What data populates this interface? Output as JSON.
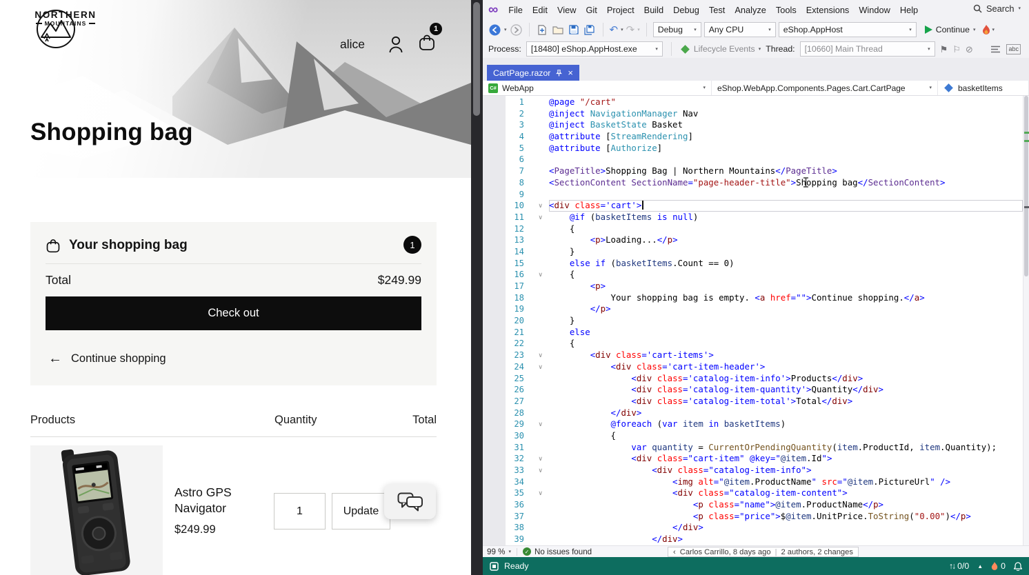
{
  "colors": {
    "status_bar": "#0D6D5F",
    "active_tab": "#4663D2",
    "checkout_button": "#0D0D0D",
    "badge": "#0B0B0B",
    "line_number": "#2B91AF"
  },
  "icons": {
    "logo_infinity": "∞",
    "back_arrow": "←",
    "forward_arrow": "→",
    "undo": "↶",
    "redo": "↷",
    "caret_down": "▾",
    "caret_up": "▲",
    "close": "×",
    "check": "✓",
    "flag": "⚑",
    "flag_outline": "⚐",
    "slash_circle": "⊘",
    "continue_left_arrow": "←",
    "fold_chevron": "∨",
    "sync_arrows": "↑↓",
    "blame_chevron": "‹",
    "pipe": "|"
  },
  "browser": {
    "logo": {
      "name_top": "NORTHERN",
      "name_bottom": "MOUNTAINS"
    },
    "nav": {
      "username": "alice",
      "cart_count": "1"
    },
    "hero": {
      "title": "Shopping bag"
    },
    "summary": {
      "title": "Your shopping bag",
      "badge": "1",
      "total_label": "Total",
      "total_value": "$249.99",
      "checkout": "Check out",
      "continue_shopping": "Continue shopping"
    },
    "cart": {
      "columns": [
        "Products",
        "Quantity",
        "Total"
      ],
      "item": {
        "name": "Astro GPS Navigator",
        "price": "$249.99",
        "quantity": "1",
        "update": "Update"
      }
    }
  },
  "ide": {
    "menus": [
      "File",
      "Edit",
      "View",
      "Git",
      "Project",
      "Build",
      "Debug",
      "Test",
      "Analyze",
      "Tools",
      "Extensions",
      "Window",
      "Help"
    ],
    "search": "Search",
    "toolbar": {
      "configuration": "Debug",
      "platform": "Any CPU",
      "startup_project": "eShop.AppHost",
      "continue_label": "Continue"
    },
    "debug_toolbar": {
      "process_label": "Process:",
      "process": "[18480] eShop.AppHost.exe",
      "lifecycle_events": "Lifecycle Events",
      "thread_label": "Thread:",
      "thread": "[10660] Main Thread"
    },
    "tabs": [
      {
        "title": "CartPage.razor",
        "active": true
      }
    ],
    "navigation_bar": {
      "project": "WebApp",
      "type": "eShop.WebApp.Components.Pages.Cart.CartPage",
      "member": "basketItems"
    },
    "editor": {
      "current_line": 10,
      "folds": [
        10,
        11,
        16,
        23,
        24,
        29,
        32,
        33,
        35
      ],
      "lines": [
        [
          [
            "@page",
            "k"
          ],
          [
            " "
          ],
          [
            "\"/cart\"",
            "s"
          ]
        ],
        [
          [
            "@inject",
            "k"
          ],
          [
            " "
          ],
          [
            "NavigationManager",
            "t"
          ],
          [
            " Nav"
          ]
        ],
        [
          [
            "@inject",
            "k"
          ],
          [
            " "
          ],
          [
            "BasketState",
            "t"
          ],
          [
            " Basket"
          ]
        ],
        [
          [
            "@attribute",
            "k"
          ],
          [
            " ["
          ],
          [
            "StreamRendering",
            "t"
          ],
          [
            "]"
          ]
        ],
        [
          [
            "@attribute",
            "k"
          ],
          [
            " ["
          ],
          [
            "Authorize",
            "t"
          ],
          [
            "]"
          ]
        ],
        [],
        [
          [
            "<",
            "p"
          ],
          [
            "PageTitle",
            "cmp"
          ],
          [
            ">",
            "p"
          ],
          [
            "Shopping Bag | Northern Mountains"
          ],
          [
            "</",
            "p"
          ],
          [
            "PageTitle",
            "cmp"
          ],
          [
            ">",
            "p"
          ]
        ],
        [
          [
            "<",
            "p"
          ],
          [
            "SectionContent",
            "cmp"
          ],
          [
            " "
          ],
          [
            "SectionName",
            "cmp"
          ],
          [
            "=",
            "p"
          ],
          [
            "\"page-header-title\"",
            "s"
          ],
          [
            ">",
            "p"
          ],
          [
            "Shopping bag"
          ],
          [
            "</",
            "p"
          ],
          [
            "SectionContent",
            "cmp"
          ],
          [
            ">",
            "p"
          ]
        ],
        [],
        [
          [
            "<",
            "p"
          ],
          [
            "div",
            "h"
          ],
          [
            " "
          ],
          [
            "class",
            "a"
          ],
          [
            "=",
            "p"
          ],
          [
            "'cart'",
            "v"
          ],
          [
            ">",
            "p"
          ]
        ],
        [
          [
            "    "
          ],
          [
            "@if",
            "k"
          ],
          [
            " ("
          ],
          [
            "basketItems",
            "loc"
          ],
          [
            " "
          ],
          [
            "is",
            "k"
          ],
          [
            " "
          ],
          [
            "null",
            "k"
          ],
          [
            ")"
          ]
        ],
        [
          [
            "    {"
          ]
        ],
        [
          [
            "        "
          ],
          [
            "<",
            "p"
          ],
          [
            "p",
            "h"
          ],
          [
            ">",
            "p"
          ],
          [
            "Loading..."
          ],
          [
            "</",
            "p"
          ],
          [
            "p",
            "h"
          ],
          [
            ">",
            "p"
          ]
        ],
        [
          [
            "    }"
          ]
        ],
        [
          [
            "    "
          ],
          [
            "else",
            "k"
          ],
          [
            " "
          ],
          [
            "if",
            "k"
          ],
          [
            " ("
          ],
          [
            "basketItems",
            "loc"
          ],
          [
            ".Count == 0)"
          ]
        ],
        [
          [
            "    {"
          ]
        ],
        [
          [
            "        "
          ],
          [
            "<",
            "p"
          ],
          [
            "p",
            "h"
          ],
          [
            ">",
            "p"
          ]
        ],
        [
          [
            "            Your shopping bag is empty. "
          ],
          [
            "<",
            "p"
          ],
          [
            "a",
            "h"
          ],
          [
            " "
          ],
          [
            "href",
            "a"
          ],
          [
            "=",
            "p"
          ],
          [
            "\"\"",
            "v"
          ],
          [
            ">",
            "p"
          ],
          [
            "Continue shopping."
          ],
          [
            "</",
            "p"
          ],
          [
            "a",
            "h"
          ],
          [
            ">",
            "p"
          ]
        ],
        [
          [
            "        "
          ],
          [
            "</",
            "p"
          ],
          [
            "p",
            "h"
          ],
          [
            ">",
            "p"
          ]
        ],
        [
          [
            "    }"
          ]
        ],
        [
          [
            "    "
          ],
          [
            "else",
            "k"
          ]
        ],
        [
          [
            "    {"
          ]
        ],
        [
          [
            "        "
          ],
          [
            "<",
            "p"
          ],
          [
            "div",
            "h"
          ],
          [
            " "
          ],
          [
            "class",
            "a"
          ],
          [
            "=",
            "p"
          ],
          [
            "'cart-items'",
            "v"
          ],
          [
            ">",
            "p"
          ]
        ],
        [
          [
            "            "
          ],
          [
            "<",
            "p"
          ],
          [
            "div",
            "h"
          ],
          [
            " "
          ],
          [
            "class",
            "a"
          ],
          [
            "=",
            "p"
          ],
          [
            "'cart-item-header'",
            "v"
          ],
          [
            ">",
            "p"
          ]
        ],
        [
          [
            "                "
          ],
          [
            "<",
            "p"
          ],
          [
            "div",
            "h"
          ],
          [
            " "
          ],
          [
            "class",
            "a"
          ],
          [
            "=",
            "p"
          ],
          [
            "'catalog-item-info'",
            "v"
          ],
          [
            ">",
            "p"
          ],
          [
            "Products"
          ],
          [
            "</",
            "p"
          ],
          [
            "div",
            "h"
          ],
          [
            ">",
            "p"
          ]
        ],
        [
          [
            "                "
          ],
          [
            "<",
            "p"
          ],
          [
            "div",
            "h"
          ],
          [
            " "
          ],
          [
            "class",
            "a"
          ],
          [
            "=",
            "p"
          ],
          [
            "'catalog-item-quantity'",
            "v"
          ],
          [
            ">",
            "p"
          ],
          [
            "Quantity"
          ],
          [
            "</",
            "p"
          ],
          [
            "div",
            "h"
          ],
          [
            ">",
            "p"
          ]
        ],
        [
          [
            "                "
          ],
          [
            "<",
            "p"
          ],
          [
            "div",
            "h"
          ],
          [
            " "
          ],
          [
            "class",
            "a"
          ],
          [
            "=",
            "p"
          ],
          [
            "'catalog-item-total'",
            "v"
          ],
          [
            ">",
            "p"
          ],
          [
            "Total"
          ],
          [
            "</",
            "p"
          ],
          [
            "div",
            "h"
          ],
          [
            ">",
            "p"
          ]
        ],
        [
          [
            "            "
          ],
          [
            "</",
            "p"
          ],
          [
            "div",
            "h"
          ],
          [
            ">",
            "p"
          ]
        ],
        [
          [
            "            "
          ],
          [
            "@foreach",
            "k"
          ],
          [
            " ("
          ],
          [
            "var",
            "k"
          ],
          [
            " "
          ],
          [
            "item",
            "loc"
          ],
          [
            " "
          ],
          [
            "in",
            "k"
          ],
          [
            " "
          ],
          [
            "basketItems",
            "loc"
          ],
          [
            ")"
          ]
        ],
        [
          [
            "            {"
          ]
        ],
        [
          [
            "                "
          ],
          [
            "var",
            "k"
          ],
          [
            " "
          ],
          [
            "quantity",
            "loc"
          ],
          [
            " = "
          ],
          [
            "CurrentOrPendingQuantity",
            "m"
          ],
          [
            "("
          ],
          [
            "item",
            "loc"
          ],
          [
            ".ProductId, "
          ],
          [
            "item",
            "loc"
          ],
          [
            ".Quantity);"
          ]
        ],
        [
          [
            "                "
          ],
          [
            "<",
            "p"
          ],
          [
            "div",
            "h"
          ],
          [
            " "
          ],
          [
            "class",
            "a"
          ],
          [
            "=",
            "p"
          ],
          [
            "\"cart-item\"",
            "v"
          ],
          [
            " "
          ],
          [
            "@key",
            "k"
          ],
          [
            "=",
            "p"
          ],
          [
            "\"",
            "v"
          ],
          [
            "@item",
            "loc"
          ],
          [
            ".Id"
          ],
          [
            "\"",
            "v"
          ],
          [
            ">",
            "p"
          ]
        ],
        [
          [
            "                    "
          ],
          [
            "<",
            "p"
          ],
          [
            "div",
            "h"
          ],
          [
            " "
          ],
          [
            "class",
            "a"
          ],
          [
            "=",
            "p"
          ],
          [
            "\"catalog-item-info\"",
            "v"
          ],
          [
            ">",
            "p"
          ]
        ],
        [
          [
            "                        "
          ],
          [
            "<",
            "p"
          ],
          [
            "img",
            "h"
          ],
          [
            " "
          ],
          [
            "alt",
            "a"
          ],
          [
            "=",
            "p"
          ],
          [
            "\"",
            "v"
          ],
          [
            "@item",
            "loc"
          ],
          [
            ".ProductName"
          ],
          [
            "\"",
            "v"
          ],
          [
            " "
          ],
          [
            "src",
            "a"
          ],
          [
            "=",
            "p"
          ],
          [
            "\"",
            "v"
          ],
          [
            "@item",
            "loc"
          ],
          [
            ".PictureUrl"
          ],
          [
            "\"",
            "v"
          ],
          [
            " />",
            "p"
          ]
        ],
        [
          [
            "                        "
          ],
          [
            "<",
            "p"
          ],
          [
            "div",
            "h"
          ],
          [
            " "
          ],
          [
            "class",
            "a"
          ],
          [
            "=",
            "p"
          ],
          [
            "\"catalog-item-content\"",
            "v"
          ],
          [
            ">",
            "p"
          ]
        ],
        [
          [
            "                            "
          ],
          [
            "<",
            "p"
          ],
          [
            "p",
            "h"
          ],
          [
            " "
          ],
          [
            "class",
            "a"
          ],
          [
            "=",
            "p"
          ],
          [
            "\"name\"",
            "v"
          ],
          [
            ">",
            "p"
          ],
          [
            "@item",
            "loc"
          ],
          [
            ".ProductName"
          ],
          [
            "</",
            "p"
          ],
          [
            "p",
            "h"
          ],
          [
            ">",
            "p"
          ]
        ],
        [
          [
            "                            "
          ],
          [
            "<",
            "p"
          ],
          [
            "p",
            "h"
          ],
          [
            " "
          ],
          [
            "class",
            "a"
          ],
          [
            "=",
            "p"
          ],
          [
            "\"price\"",
            "v"
          ],
          [
            ">",
            "p"
          ],
          [
            "$"
          ],
          [
            "@item",
            "loc"
          ],
          [
            ".UnitPrice."
          ],
          [
            "ToString",
            "m"
          ],
          [
            "("
          ],
          [
            "\"0.00\"",
            "s"
          ],
          [
            ")"
          ],
          [
            "</",
            "p"
          ],
          [
            "p",
            "h"
          ],
          [
            ">",
            "p"
          ]
        ],
        [
          [
            "                        "
          ],
          [
            "</",
            "p"
          ],
          [
            "div",
            "h"
          ],
          [
            ">",
            "p"
          ]
        ],
        [
          [
            "                    "
          ],
          [
            "</",
            "p"
          ],
          [
            "div",
            "h"
          ],
          [
            ">",
            "p"
          ]
        ]
      ]
    },
    "document_bar": {
      "zoom": "99 %",
      "health": "No issues found",
      "blame": "Carlos Carrillo, 8 days ago",
      "changes": "2 authors, 2 changes"
    },
    "status_bar": {
      "message": "Ready",
      "sync": "0/0",
      "hot_reload_count": "0"
    }
  }
}
